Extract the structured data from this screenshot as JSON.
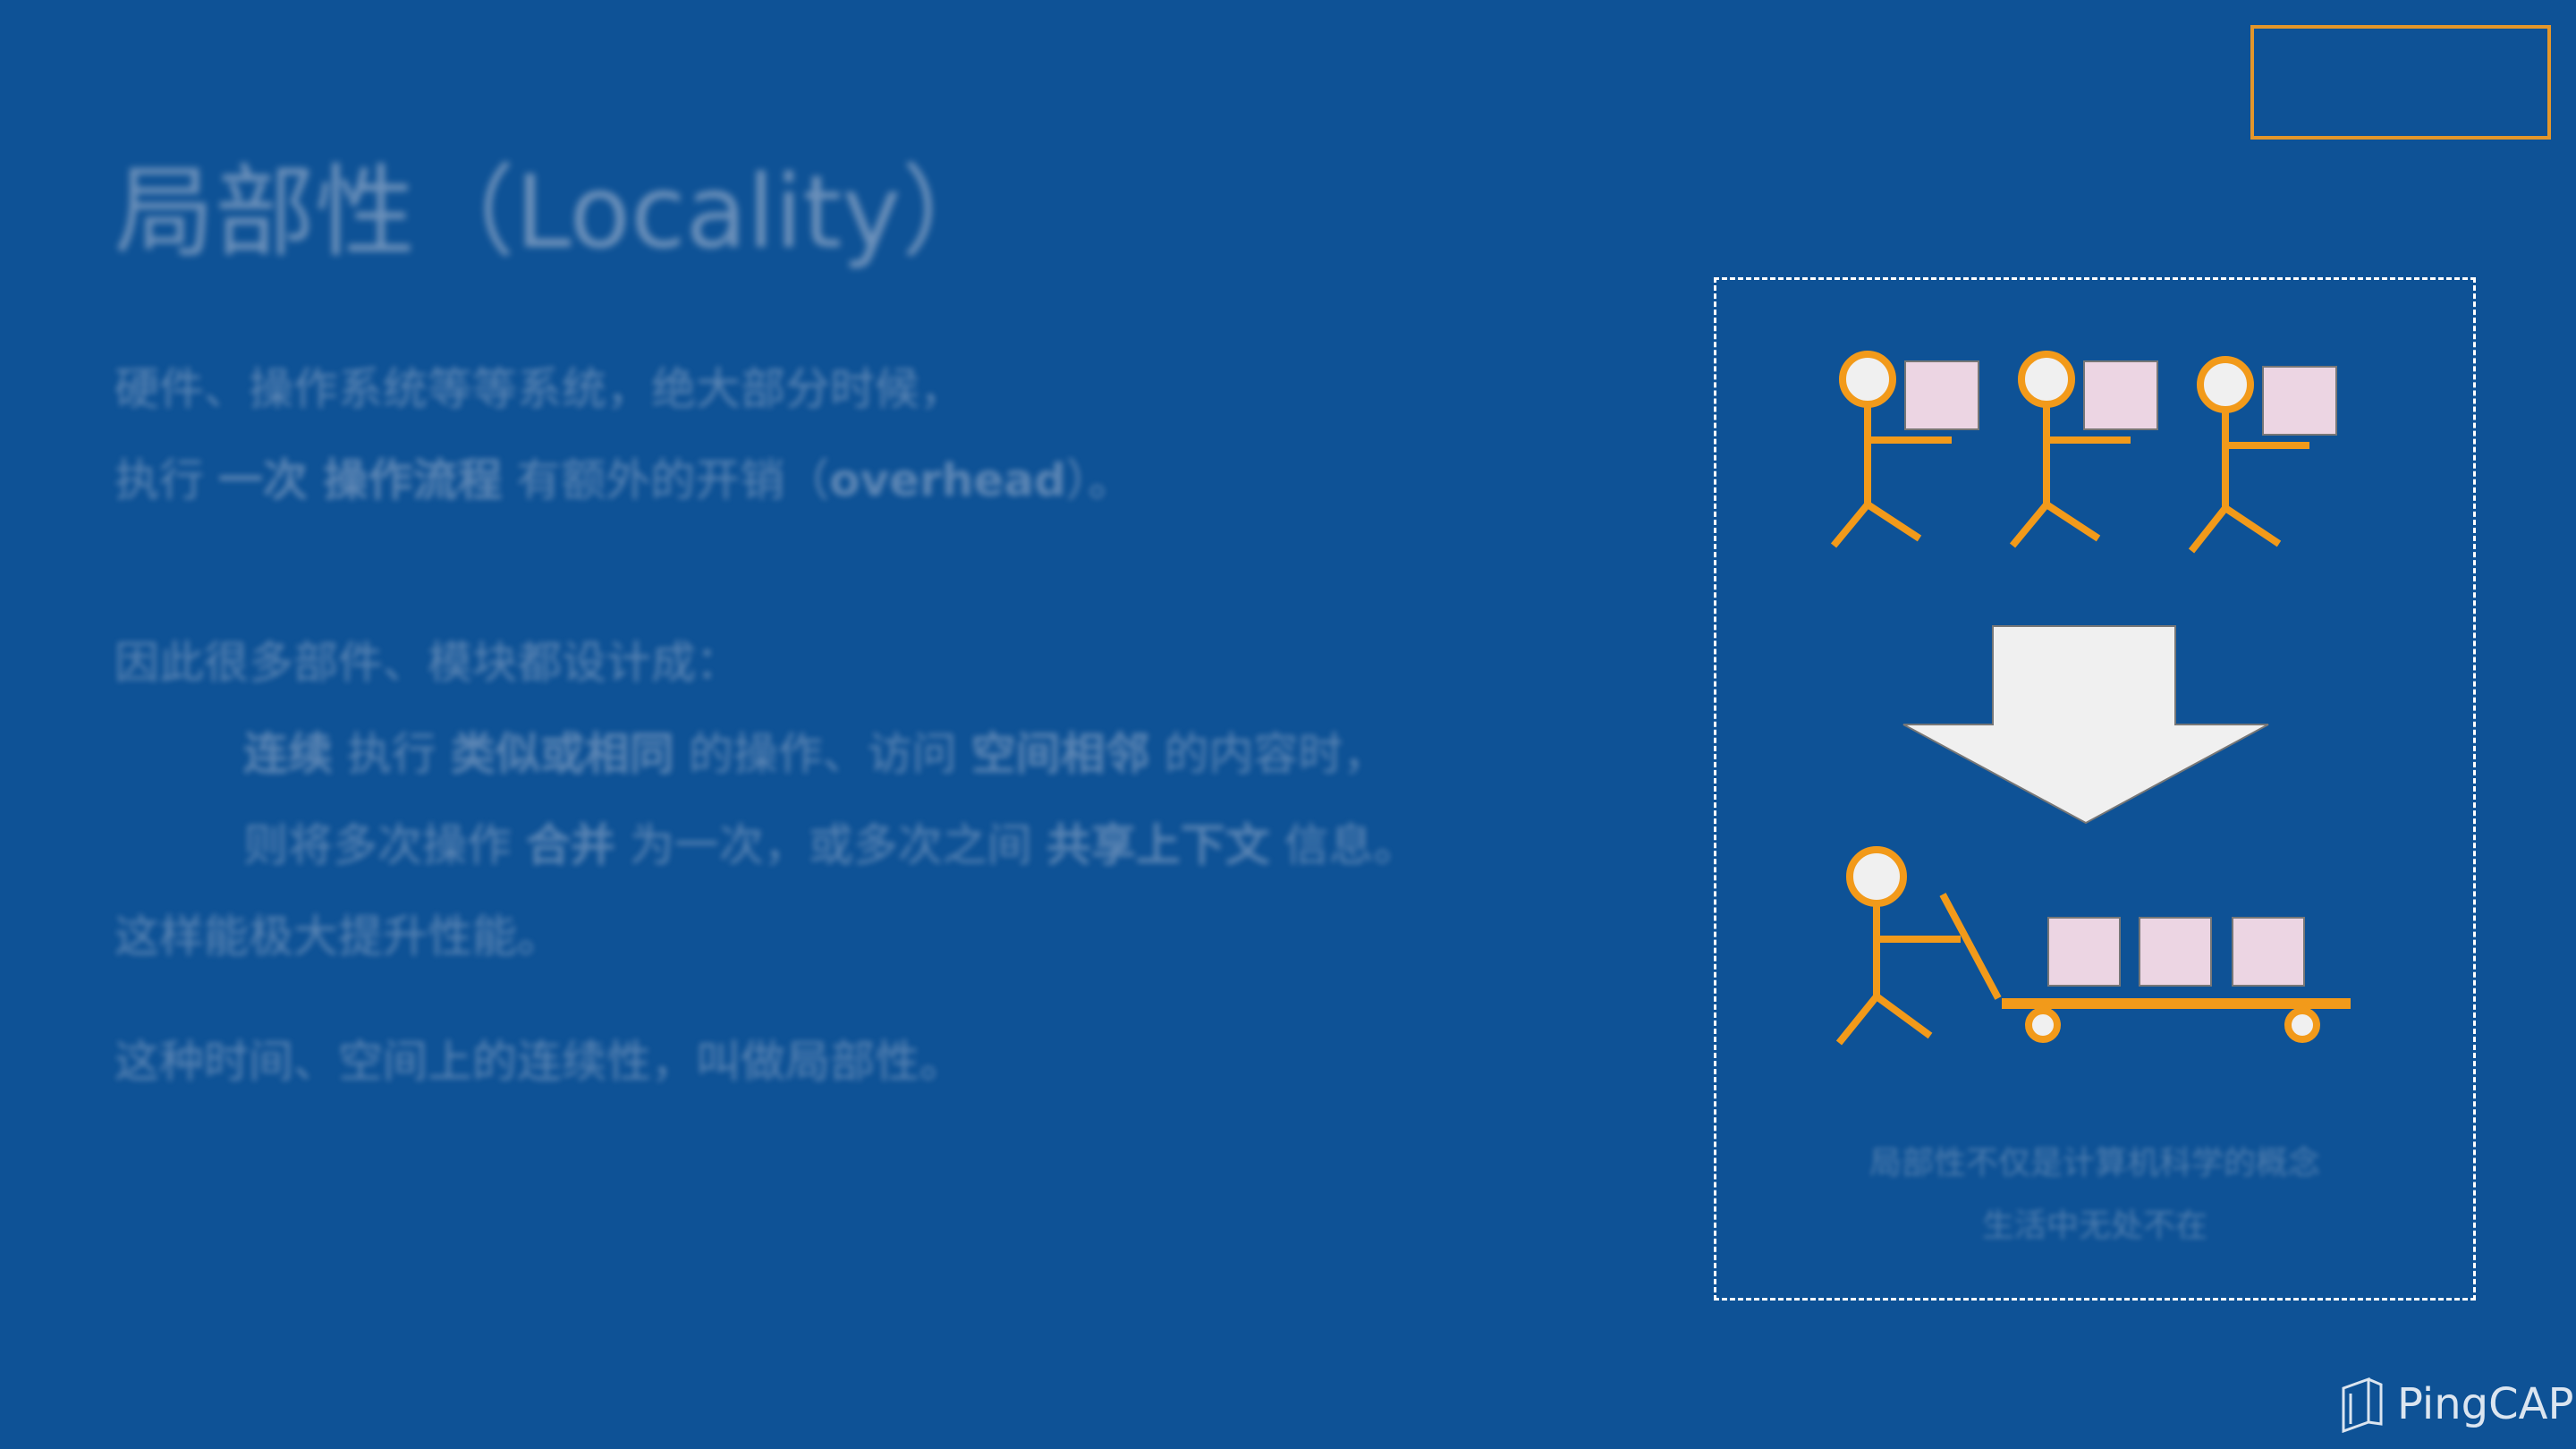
{
  "slide": {
    "title": "局部性（Locality）",
    "paragraph1": {
      "line1": "硬件、操作系统等等系统，绝大部分时候，",
      "line2_parts": [
        "执行 ",
        "一次 操作流程",
        " 有额外的开销（",
        "overhead",
        "）。"
      ]
    },
    "paragraph2": {
      "intro": "因此很多部件、模块都设计成：",
      "line_a_parts": [
        "连续",
        " 执行 ",
        "类似或相同",
        " 的操作、访问 ",
        "空间相邻",
        " 的内容时，"
      ],
      "line_b_parts": [
        "则将多次操作 ",
        "合并",
        " 为一次，或多次之间 ",
        "共享上下文",
        " 信息。"
      ],
      "conclusion": "这样能极大提升性能。"
    },
    "paragraph3": "这种时间、空间上的连续性，叫做局部性。"
  },
  "illustration": {
    "caption_line1": "局部性不仅是计算机科学的概念",
    "caption_line2": "生活中无处不在",
    "colors": {
      "figure": "#f29a1a",
      "box_fill": "#ecd5e3",
      "arrow_fill": "#f0f0f0",
      "frame": "#ffffff",
      "corner_box": "#e3962a"
    }
  },
  "logo": {
    "text": "PingCAP",
    "icon": "pingcap-logo-icon"
  }
}
